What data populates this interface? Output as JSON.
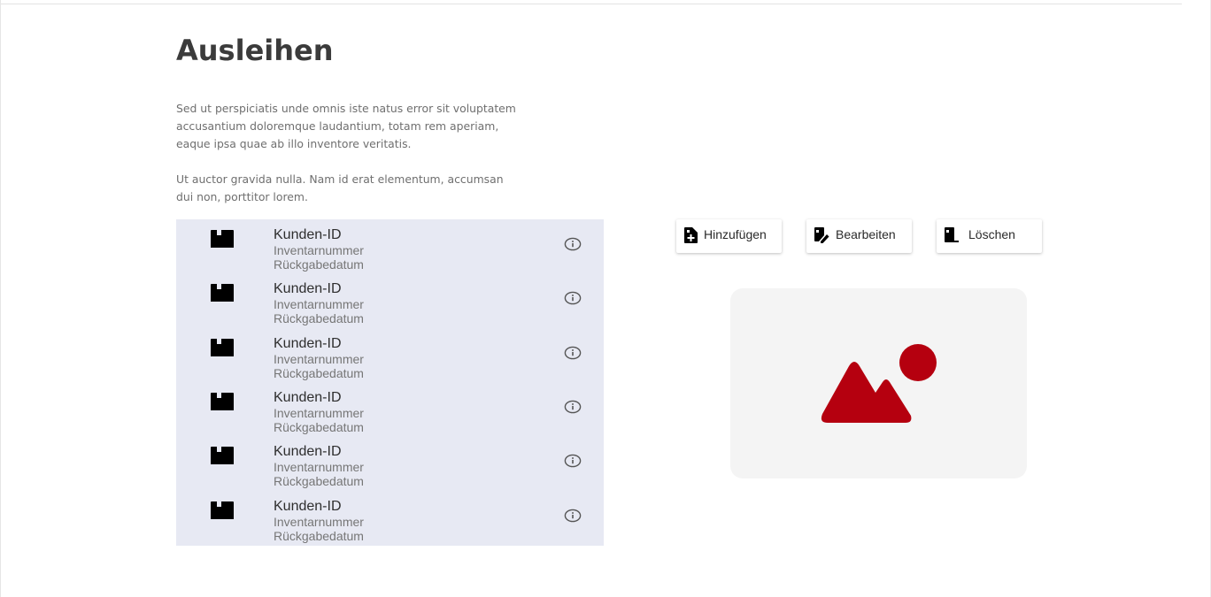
{
  "page": {
    "title": "Ausleihen",
    "intro_paragraphs": [
      "Sed ut perspiciatis unde omnis iste natus error sit voluptatem accusantium doloremque laudantium, totam rem aperiam, eaque ipsa quae ab illo inventore veritatis.",
      "Ut auctor gravida nulla. Nam id erat elementum, accumsan dui non, porttitor lorem."
    ]
  },
  "list": {
    "items": [
      {
        "title": "Kunden-ID",
        "line1": "Inventarnummer",
        "line2": "Rückgabedatum",
        "icon": "box-icon",
        "action_icon": "info-icon"
      },
      {
        "title": "Kunden-ID",
        "line1": "Inventarnummer",
        "line2": "Rückgabedatum",
        "icon": "box-icon",
        "action_icon": "info-icon"
      },
      {
        "title": "Kunden-ID",
        "line1": "Inventarnummer",
        "line2": "Rückgabedatum",
        "icon": "box-icon",
        "action_icon": "info-icon"
      },
      {
        "title": "Kunden-ID",
        "line1": "Inventarnummer",
        "line2": "Rückgabedatum",
        "icon": "box-icon",
        "action_icon": "info-icon"
      },
      {
        "title": "Kunden-ID",
        "line1": "Inventarnummer",
        "line2": "Rückgabedatum",
        "icon": "box-icon",
        "action_icon": "info-icon"
      },
      {
        "title": "Kunden-ID",
        "line1": "Inventarnummer",
        "line2": "Rückgabedatum",
        "icon": "box-icon",
        "action_icon": "info-icon"
      }
    ]
  },
  "actions": {
    "add_label": "Hinzufügen",
    "edit_label": "Bearbeiten",
    "delete_label": "Löschen",
    "add_icon": "add-item-icon",
    "edit_icon": "edit-item-icon",
    "delete_icon": "delete-item-icon"
  },
  "image_placeholder": {
    "icon": "image-placeholder-icon"
  },
  "colors": {
    "list_background": "#e7e9f3",
    "image_accent": "#b5000f",
    "placeholder_background": "#f4f4f4"
  }
}
